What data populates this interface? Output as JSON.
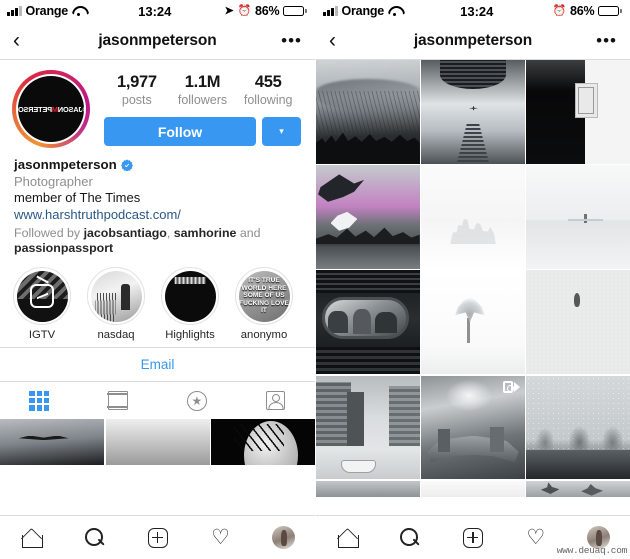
{
  "status_bar": {
    "carrier": "Orange",
    "time": "13:24",
    "battery_percent": "86%",
    "battery_level": 86,
    "icons": [
      "signal-bars-icon",
      "wifi-icon",
      "location-arrow-icon",
      "alarm-clock-icon",
      "battery-icon"
    ]
  },
  "nav": {
    "back_label": "‹",
    "title": "jasonmpeterson",
    "more_label": "•••"
  },
  "profile": {
    "avatar_text_main": "@JASON",
    "avatar_text_accent": "M",
    "avatar_text_tail": "PETERSON",
    "stats": [
      {
        "value": "1,977",
        "label": "posts"
      },
      {
        "value": "1.1M",
        "label": "followers"
      },
      {
        "value": "455",
        "label": "following"
      }
    ],
    "follow_label": "Follow",
    "dropdown_label": "▾",
    "username": "jasonmpeterson",
    "verified": true,
    "category": "Photographer",
    "bio_line": "member of The Times",
    "link": "www.harshtruthpodcast.com/",
    "followed_by_prefix": "Followed by ",
    "followed_by_names": [
      "jacobsantiago",
      "samhorine",
      "passionpassport"
    ],
    "followed_by_joiner": ", ",
    "followed_by_and": " and ",
    "email_label": "Email"
  },
  "highlights": [
    {
      "label": "IGTV",
      "icon": "igtv-icon"
    },
    {
      "label": "nasdaq",
      "icon": "highlight-cover-nasdaq"
    },
    {
      "label": "Highlights",
      "icon": "highlight-cover-highlights"
    },
    {
      "label": "anonymo",
      "icon": "highlight-cover-anonymous",
      "text": "IT'S TRUE\nWORLD HERE\nSOME OF US\nFUCKING\nLOVE IT"
    }
  ],
  "tabs": [
    {
      "name": "grid-tab",
      "icon": "grid-icon",
      "active": true
    },
    {
      "name": "feed-tab",
      "icon": "feed-list-icon",
      "active": false
    },
    {
      "name": "saved-tab",
      "icon": "star-circle-icon",
      "active": false
    },
    {
      "name": "tagged-tab",
      "icon": "tagged-person-icon",
      "active": false
    }
  ],
  "left_grid": [
    {
      "alt": "seagull-over-clouds"
    },
    {
      "alt": "grey-gradient"
    },
    {
      "alt": "moon-behind-branches"
    }
  ],
  "right_grid": [
    {
      "alt": "storm-over-city-skyline",
      "video": false
    },
    {
      "alt": "skyscrapers-with-airplane",
      "video": false
    },
    {
      "alt": "dark-light-abstract",
      "video": false
    },
    {
      "alt": "seagull-over-waterfront",
      "video": false
    },
    {
      "alt": "foggy-city-skyline",
      "video": false
    },
    {
      "alt": "minimal-seascape-figure",
      "video": false
    },
    {
      "alt": "train-window-passengers",
      "video": false
    },
    {
      "alt": "lone-tree-in-snow",
      "video": false
    },
    {
      "alt": "figure-walking-in-snow",
      "video": false
    },
    {
      "alt": "city-river-boat",
      "video": false
    },
    {
      "alt": "cloud-gate-bean-snow",
      "video": true
    },
    {
      "alt": "row-of-trees-snow",
      "video": false
    },
    {
      "alt": "grey-gradient-strip",
      "video": false
    },
    {
      "alt": "white-gradient-strip",
      "video": false
    },
    {
      "alt": "dark-snow-strip",
      "video": false
    }
  ],
  "bottom_nav": [
    {
      "name": "home-nav",
      "icon": "home-icon"
    },
    {
      "name": "search-nav",
      "icon": "search-icon"
    },
    {
      "name": "create-nav",
      "icon": "plus-square-icon"
    },
    {
      "name": "activity-nav",
      "icon": "heart-icon"
    },
    {
      "name": "profile-nav",
      "icon": "profile-avatar-icon"
    }
  ],
  "watermark": "www.deuaq.com",
  "colors": {
    "accent_blue": "#3897f0",
    "link_blue": "#2a5885",
    "muted": "#8e8e8e",
    "border": "#dbdbdb",
    "verified_blue": "#3897f0",
    "story_ring_from": "#f09433",
    "story_ring_to": "#bc1888"
  }
}
